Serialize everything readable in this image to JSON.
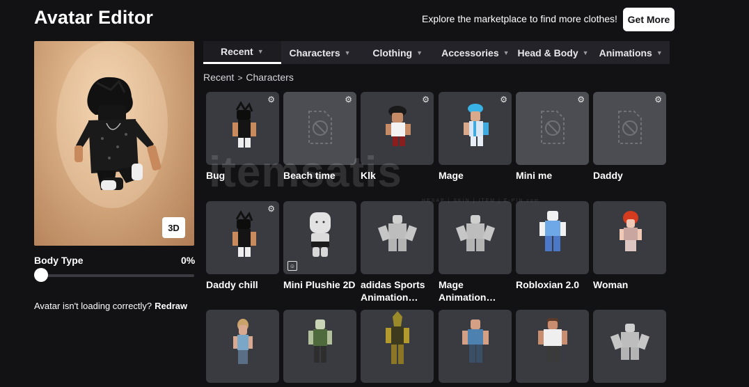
{
  "header": {
    "title": "Avatar Editor",
    "explore_text": "Explore the marketplace to find more clothes!",
    "get_more_label": "Get More"
  },
  "preview": {
    "view_3d_label": "3D",
    "body_type_label": "Body Type",
    "body_type_value": "0%",
    "body_type_fraction": 0,
    "loading_issue_text": "Avatar isn't loading correctly?",
    "redraw_label": "Redraw"
  },
  "tabs": [
    {
      "label": "Recent",
      "active": true
    },
    {
      "label": "Characters",
      "active": false
    },
    {
      "label": "Clothing",
      "active": false
    },
    {
      "label": "Accessories",
      "active": false
    },
    {
      "label": "Head & Body",
      "active": false
    },
    {
      "label": "Animations",
      "active": false
    }
  ],
  "breadcrumb": {
    "parent": "Recent",
    "current": "Characters"
  },
  "items": [
    {
      "name": "Bug",
      "thumb": "black-hair-avatar",
      "has_settings": true
    },
    {
      "name": "Beach time",
      "thumb": "placeholder",
      "has_settings": true
    },
    {
      "name": "Klk",
      "thumb": "white-shirt-avatar",
      "has_settings": true
    },
    {
      "name": "Mage",
      "thumb": "blue-hair-avatar",
      "has_settings": true
    },
    {
      "name": "Mini me",
      "thumb": "placeholder",
      "has_settings": true
    },
    {
      "name": "Daddy",
      "thumb": "placeholder",
      "has_settings": true
    },
    {
      "name": "Daddy chill",
      "thumb": "black-hair-avatar",
      "has_settings": true
    },
    {
      "name": "Mini Plushie 2D",
      "thumb": "plushie",
      "has_settings": false,
      "badge": "smiley-icon"
    },
    {
      "name": "adidas Sports Animation…",
      "thumb": "grey-rig",
      "has_settings": false
    },
    {
      "name": "Mage Animation…",
      "thumb": "grey-rig",
      "has_settings": false
    },
    {
      "name": "Robloxian 2.0",
      "thumb": "robloxian",
      "has_settings": false
    },
    {
      "name": "Woman",
      "thumb": "woman",
      "has_settings": false
    },
    {
      "name": "",
      "thumb": "girl",
      "has_settings": false
    },
    {
      "name": "",
      "thumb": "zombie",
      "has_settings": false
    },
    {
      "name": "",
      "thumb": "gold",
      "has_settings": false
    },
    {
      "name": "",
      "thumb": "man-blue",
      "has_settings": false
    },
    {
      "name": "",
      "thumb": "man-white",
      "has_settings": false
    },
    {
      "name": "",
      "thumb": "grey-rig",
      "has_settings": false
    }
  ],
  "watermark": {
    "text": "itemsatis",
    "sub": "HESAP | SKIN | ITEM | E-PIN",
    "suffix": ".com"
  }
}
